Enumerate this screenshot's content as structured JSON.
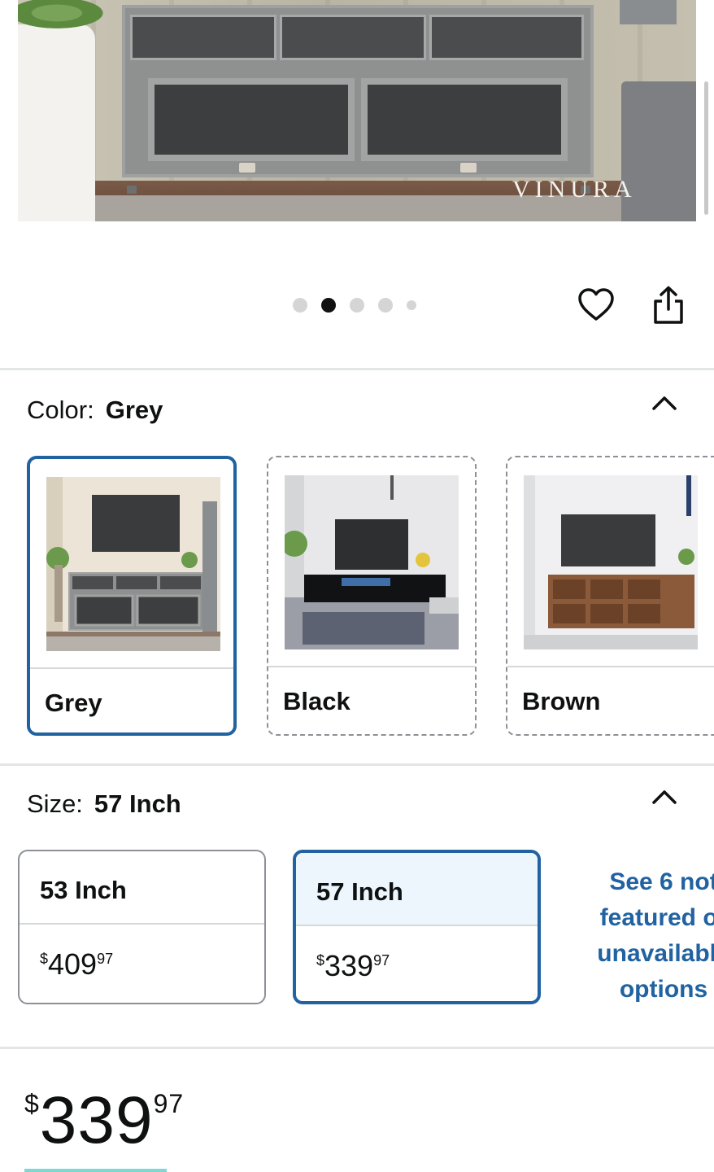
{
  "hero": {
    "brand_watermark": "VINURA",
    "carousel_count": 5,
    "carousel_active_index": 1
  },
  "color_section": {
    "label": "Color:",
    "selected_value": "Grey",
    "options": [
      {
        "name": "Grey",
        "selected": true
      },
      {
        "name": "Black",
        "selected": false
      },
      {
        "name": "Brown",
        "selected": false
      }
    ]
  },
  "size_section": {
    "label": "Size:",
    "selected_value": "57 Inch",
    "options": [
      {
        "name": "53 Inch",
        "price_currency": "$",
        "price_whole": "409",
        "price_cents": "97",
        "selected": false
      },
      {
        "name": "57 Inch",
        "price_currency": "$",
        "price_whole": "339",
        "price_cents": "97",
        "selected": true
      }
    ],
    "see_more_lines": [
      "See 6 not",
      "featured or",
      "unavailable",
      "options"
    ]
  },
  "price": {
    "currency": "$",
    "whole": "339",
    "cents": "97"
  },
  "colors": {
    "selected_border": "#2162a1",
    "link": "#2162a1",
    "selected_fill": "#edf6fd"
  }
}
